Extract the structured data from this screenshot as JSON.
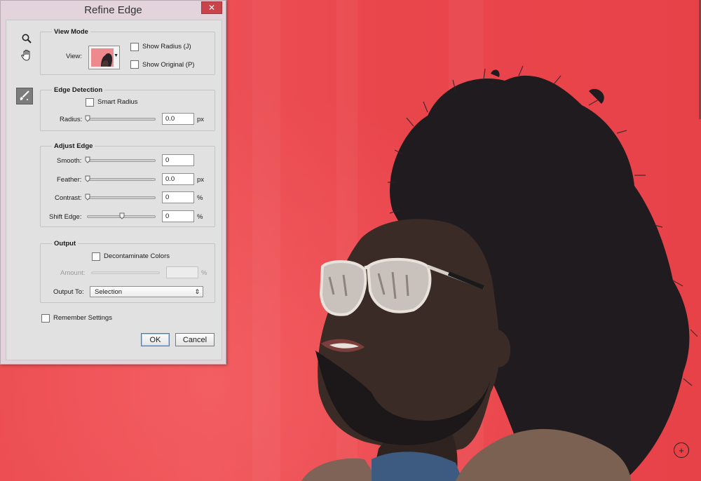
{
  "dialog": {
    "title": "Refine Edge",
    "close_icon": "close-icon",
    "title_color": "#e3d4dc",
    "close_color": "#c9434a"
  },
  "tools": {
    "zoom": "zoom-icon",
    "hand": "hand-icon",
    "refine_brush": "refine-radius-brush-icon"
  },
  "view_mode": {
    "title": "View Mode",
    "view_label": "View:",
    "show_radius_label": "Show Radius (J)",
    "show_radius_checked": false,
    "show_original_label": "Show Original (P)",
    "show_original_checked": false
  },
  "edge_detection": {
    "title": "Edge Detection",
    "smart_radius_label": "Smart Radius",
    "smart_radius_checked": false,
    "radius_label": "Radius:",
    "radius_value": "0.0",
    "radius_unit": "px",
    "radius_level": 0
  },
  "adjust_edge": {
    "title": "Adjust Edge",
    "smooth_label": "Smooth:",
    "smooth_value": "0",
    "smooth_level": 0,
    "feather_label": "Feather:",
    "feather_value": "0.0",
    "feather_unit": "px",
    "feather_level": 0,
    "contrast_label": "Contrast:",
    "contrast_value": "0",
    "contrast_unit": "%",
    "contrast_level": 0,
    "shift_edge_label": "Shift Edge:",
    "shift_edge_value": "0",
    "shift_edge_unit": "%",
    "shift_edge_level": 0.5
  },
  "output": {
    "title": "Output",
    "decontaminate_label": "Decontaminate Colors",
    "decontaminate_checked": false,
    "amount_label": "Amount:",
    "amount_value": "",
    "amount_unit": "%",
    "output_to_label": "Output To:",
    "output_to_value": "Selection"
  },
  "remember_settings_label": "Remember Settings",
  "remember_settings_checked": false,
  "buttons": {
    "ok": "OK",
    "cancel": "Cancel"
  },
  "canvas": {
    "background_color": "#e9474d",
    "cursor_icon": "zoom-in-cursor-icon"
  }
}
